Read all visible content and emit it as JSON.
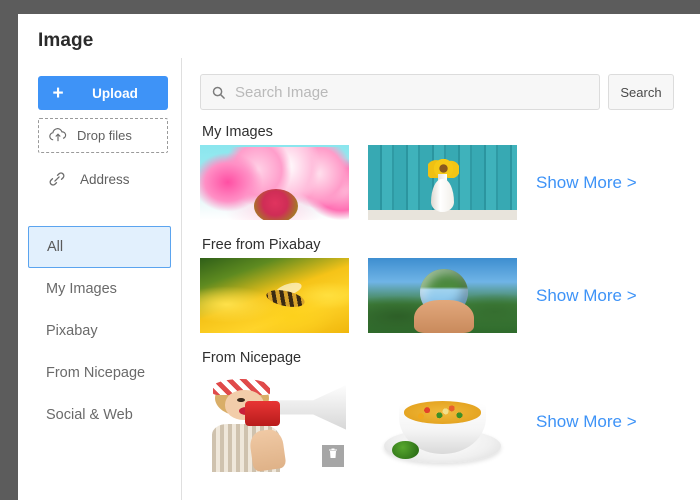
{
  "modal": {
    "title": "Image"
  },
  "sidebar": {
    "upload": {
      "label": "Upload",
      "plus_icon": "plus-icon"
    },
    "drop_files": {
      "label": "Drop files",
      "icon": "cloud-upload-icon"
    },
    "address": {
      "label": "Address",
      "icon": "link-icon"
    },
    "nav_items": [
      {
        "label": "All",
        "selected": true
      },
      {
        "label": "My Images",
        "selected": false
      },
      {
        "label": "Pixabay",
        "selected": false
      },
      {
        "label": "From Nicepage",
        "selected": false
      },
      {
        "label": "Social & Web",
        "selected": false
      }
    ]
  },
  "search": {
    "placeholder": "Search Image",
    "value": "",
    "icon": "search-icon",
    "button_label": "Search"
  },
  "sections": [
    {
      "title": "My Images",
      "show_more_label": "Show More >",
      "thumbnails": [
        {
          "name": "pink-daisy-flower",
          "selected": false
        },
        {
          "name": "sunflower-in-vase-on-teal-planks",
          "selected": false
        }
      ]
    },
    {
      "title": "Free from Pixabay",
      "show_more_label": "Show More >",
      "thumbnails": [
        {
          "name": "bee-on-yellow-flower",
          "selected": false
        },
        {
          "name": "hand-holding-glass-sphere",
          "selected": false
        }
      ]
    },
    {
      "title": "From Nicepage",
      "show_more_label": "Show More >",
      "thumbnails": [
        {
          "name": "woman-with-megaphone",
          "selected": true,
          "delete_icon": "trash-icon"
        },
        {
          "name": "bowl-of-vegetable-soup",
          "selected": false
        }
      ]
    }
  ],
  "colors": {
    "accent": "#3e93f7",
    "selected_fill": "#e2f0fd",
    "overlay": "#5c5c5c",
    "panel": "#ffffff"
  }
}
